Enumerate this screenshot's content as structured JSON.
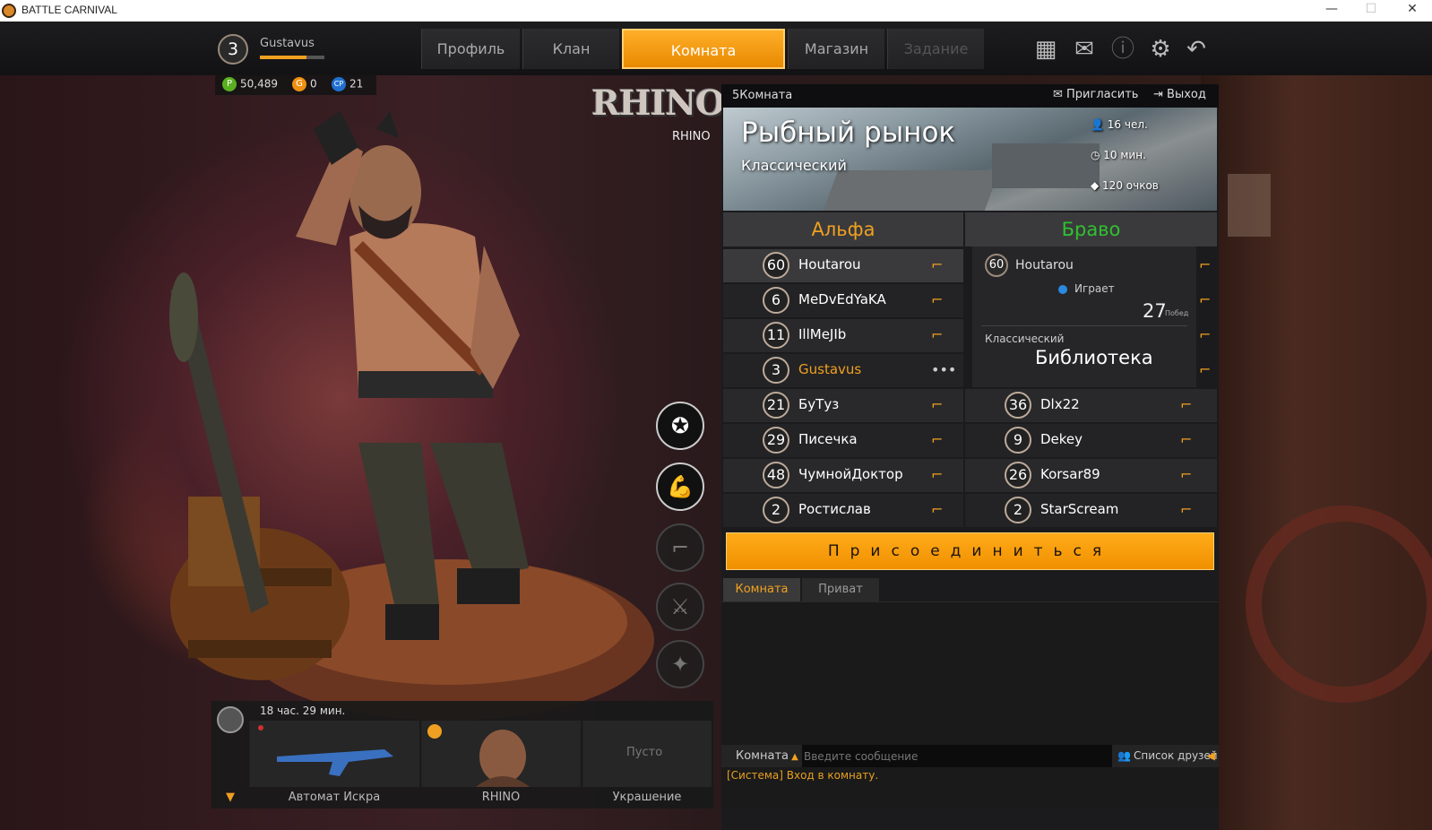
{
  "window": {
    "title": "BATTLE CARNIVAL",
    "minimize": "—",
    "maximize": "☐",
    "close": "✕"
  },
  "player": {
    "level": "3",
    "name": "Gustavus",
    "xp_fraction": 0.72
  },
  "currency": [
    {
      "icon": "P",
      "value": "50,489",
      "color": "#5ab020"
    },
    {
      "icon": "G",
      "value": "0",
      "color": "#f09010"
    },
    {
      "icon": "CP",
      "value": "21",
      "color": "#2070d0"
    }
  ],
  "nav": {
    "profile": "Профиль",
    "clan": "Клан",
    "room": "Комната",
    "shop": "Магазин",
    "quest": "Задание"
  },
  "character": {
    "logo": "RHINO",
    "name": "RHINO"
  },
  "loadout": {
    "timer": "18 час. 29 мин.",
    "slots": [
      "Автомат Искра",
      "RHINO",
      "Украшение"
    ],
    "empty": "Пусто"
  },
  "room": {
    "title": "5Комната",
    "invite": "Пригласить",
    "exit": "Выход",
    "map_name": "Рыбный рынок",
    "map_mode": "Классический",
    "players": "16 чел.",
    "time": "10 мин.",
    "score": "120 очков",
    "team_alpha": "Альфа",
    "team_bravo": "Браво",
    "alpha": [
      {
        "level": "60",
        "name": "Houtarou"
      },
      {
        "level": "6",
        "name": "MeDvEdYaKA"
      },
      {
        "level": "11",
        "name": "IllMeJIb"
      },
      {
        "level": "3",
        "name": "Gustavus"
      },
      {
        "level": "21",
        "name": "БуТуз"
      },
      {
        "level": "29",
        "name": "Писечка"
      },
      {
        "level": "48",
        "name": "ЧумнойДоктор"
      },
      {
        "level": "2",
        "name": "Ростислав"
      }
    ],
    "bravo_card": {
      "level": "60",
      "name": "Houtarou",
      "status": "Играет",
      "wins": "27",
      "wins_label": "Побед",
      "mode": "Классический",
      "map": "Библиотека"
    },
    "bravo": [
      {
        "level": "36",
        "name": "Dlx22"
      },
      {
        "level": "9",
        "name": "Dekey"
      },
      {
        "level": "26",
        "name": "Korsar89"
      },
      {
        "level": "2",
        "name": "StarScream"
      }
    ],
    "join": "Присоединиться",
    "chat_tabs": [
      "Комната",
      "Приват"
    ],
    "system_msg": "[Система] Вход в комнату.",
    "channel": "Комната",
    "input_placeholder": "Введите сообщение",
    "friends": "Список друзей"
  },
  "colors": {
    "accent": "#f5a010",
    "alpha": "#f0a020",
    "bravo": "#30c030"
  }
}
